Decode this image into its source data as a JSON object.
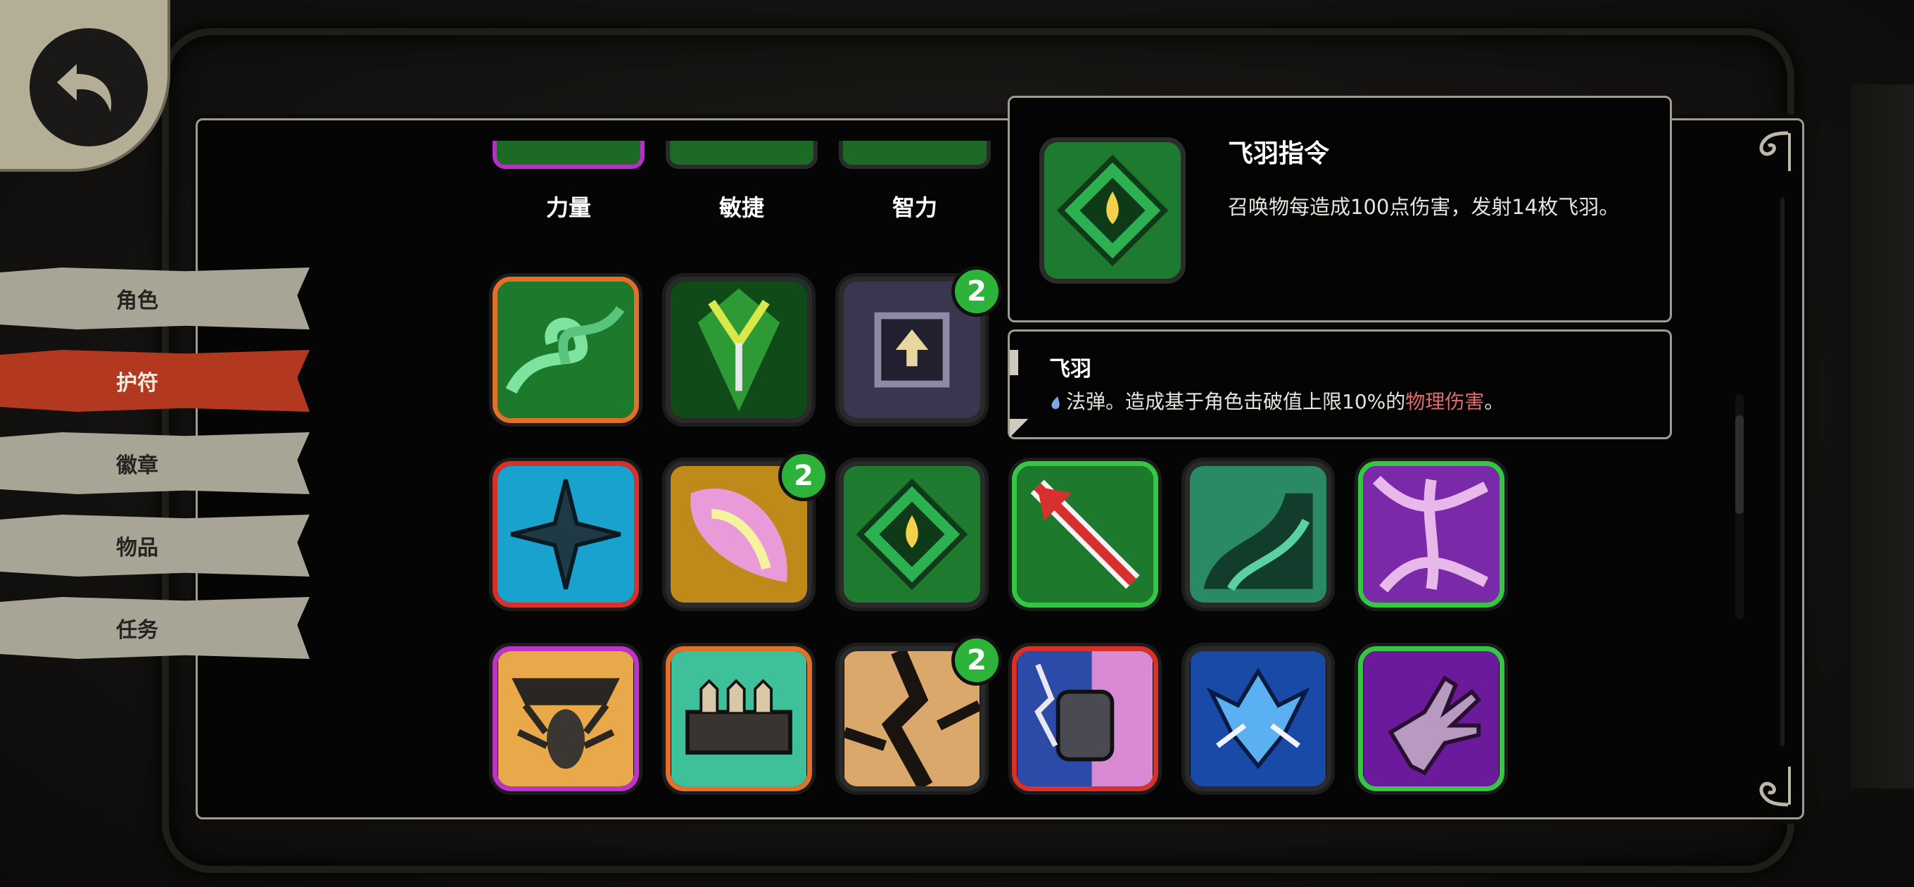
{
  "sidebar": {
    "tabs": [
      {
        "label": "角色",
        "active": false
      },
      {
        "label": "护符",
        "active": true
      },
      {
        "label": "徽章",
        "active": false
      },
      {
        "label": "物品",
        "active": false
      },
      {
        "label": "任务",
        "active": false
      }
    ]
  },
  "attributes": [
    {
      "label": "力量",
      "color": "#b62fc7"
    },
    {
      "label": "敏捷",
      "color": "#2a2a2a"
    },
    {
      "label": "智力",
      "color": "#2a2a2a"
    }
  ],
  "tooltip": {
    "title": "飞羽指令",
    "description": "召唤物每造成100点伤害，发射14枚飞羽。",
    "sub_title": "飞羽",
    "sub_desc_prefix": "法弹。造成基于角色击破值上限10%的",
    "sub_desc_highlight": "物理伤害",
    "sub_desc_suffix": "。"
  },
  "badges": {
    "row1_col3": "2",
    "row2_col2": "2",
    "row3_col3": "2"
  },
  "icon_names": [
    "green-swirl-charm",
    "green-leaf-blade-charm",
    "dark-gate-arrow-charm",
    "blue-star-charm",
    "pink-feather-charm",
    "green-diamond-eye-charm",
    "red-arrow-charm",
    "teal-claw-charm",
    "purple-web-charm",
    "spider-charm",
    "ammo-belt-charm",
    "crack-charm",
    "fist-lightning-charm",
    "blue-dragon-charm",
    "purple-hand-charm"
  ],
  "colors": {
    "active_tab": "#b2391f",
    "inactive_tab": "#a8a597",
    "badge_green": "#2eb33a",
    "highlight_red": "#e06a6a"
  }
}
